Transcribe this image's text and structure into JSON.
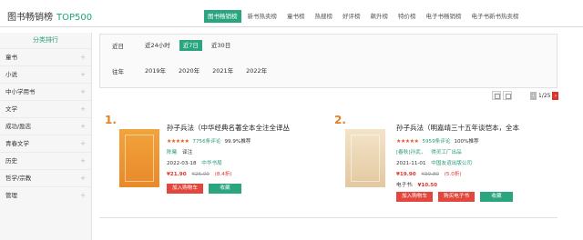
{
  "header": {
    "title": "图书畅销榜",
    "subtitle": "TOP500",
    "tabs": [
      {
        "label": "图书畅销榜",
        "active": true
      },
      {
        "label": "新书热卖榜"
      },
      {
        "label": "童书榜"
      },
      {
        "label": "热搜榜"
      },
      {
        "label": "好评榜"
      },
      {
        "label": "飙升榜"
      },
      {
        "label": "特价榜"
      },
      {
        "label": "电子书畅销榜"
      },
      {
        "label": "电子书新书热卖榜"
      }
    ]
  },
  "sidebar": {
    "title": "分类排行",
    "items": [
      "童书",
      "小说",
      "中小学用书",
      "文学",
      "成功/励志",
      "青春文学",
      "历史",
      "哲学/宗教",
      "管理"
    ]
  },
  "filter": {
    "recent_label": "近日",
    "recent_options": [
      "近24小时",
      "近7日",
      "近30日"
    ],
    "recent_active": "近7日",
    "past_label": "往年",
    "past_options": [
      "2019年",
      "2020年",
      "2021年",
      "2022年"
    ]
  },
  "pager": {
    "text": "1/25"
  },
  "books": [
    {
      "rank": "1.",
      "title": "孙子兵法（中华经典名著全本全注全译丛",
      "stars": "★★★★★",
      "reviews": "7756条评论",
      "recommend": "99.9%推荐",
      "author": "陈曦",
      "author_role": "译注",
      "date": "2022-03-18",
      "publisher": "中华书局",
      "price": "¥21.90",
      "original_price": "¥26.00",
      "discount": "(8.4折)",
      "cart_label": "加入购物车",
      "fav_label": "收藏"
    },
    {
      "rank": "2.",
      "title": "孙子兵法（明嘉靖三十五年谈恺本，全本",
      "stars": "★★★★★",
      "reviews": "5959条评论",
      "recommend": "100%推荐",
      "author": "[春秋]孙武，",
      "author_extra": "得灵工厂出品",
      "date": "2021-11-01",
      "publisher": "中国友谊出版公司",
      "price": "¥19.90",
      "original_price": "¥39.80",
      "discount": "(5.0折)",
      "ebook_label": "电子书:",
      "ebook_price": "¥10.50",
      "cart_label": "加入购物车",
      "ebook_button": "购买电子书",
      "fav_label": "收藏"
    }
  ]
}
